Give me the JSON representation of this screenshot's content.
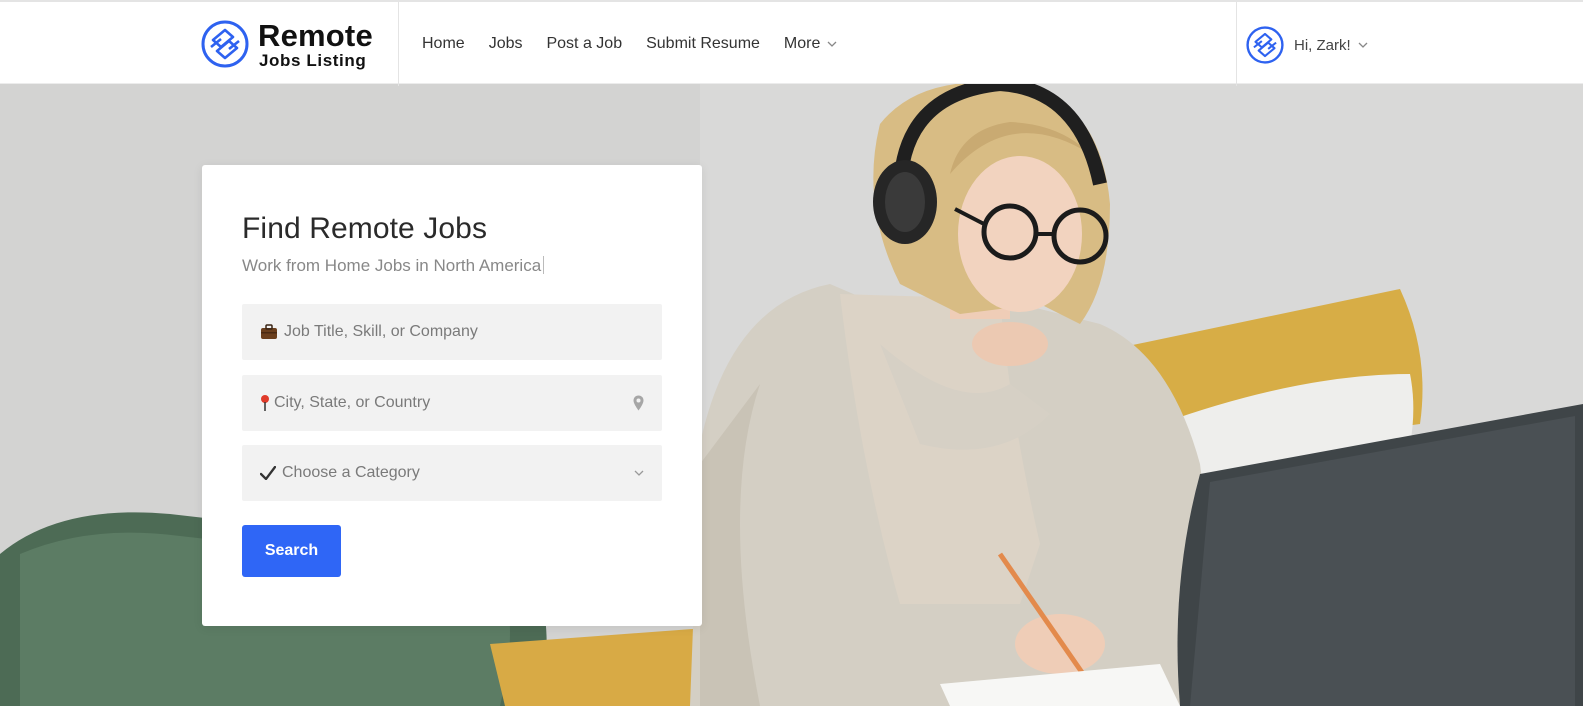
{
  "header": {
    "logo_title": "Remote",
    "logo_subtitle": "Jobs Listing",
    "nav": [
      {
        "label": "Home"
      },
      {
        "label": "Jobs"
      },
      {
        "label": "Post a Job"
      },
      {
        "label": "Submit Resume"
      },
      {
        "label": "More",
        "has_dropdown": true
      }
    ],
    "user_greeting": "Hi, Zark!"
  },
  "search": {
    "title": "Find Remote Jobs",
    "subtitle": "Work from Home Jobs in North America",
    "keyword_placeholder": "Job Title, Skill, or Company",
    "keyword_icon": "briefcase-icon",
    "location_placeholder": "City, State, or Country",
    "location_icon": "pushpin-icon",
    "location_action_icon": "map-marker-icon",
    "category_placeholder": "Choose a Category",
    "category_icon": "check-mark-icon",
    "button_label": "Search"
  },
  "colors": {
    "accent": "#2f66f6",
    "logo_blue": "#2e62f0",
    "field_bg": "#f2f2f2"
  }
}
